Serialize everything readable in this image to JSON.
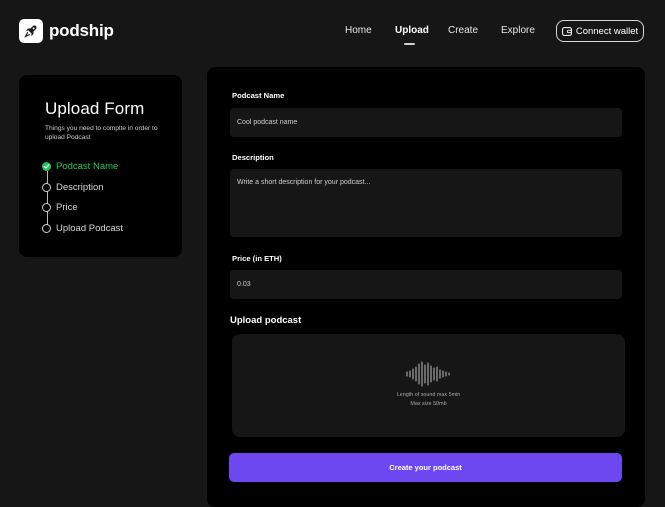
{
  "header": {
    "brand": "podship",
    "nav": [
      {
        "label": "Home",
        "active": false
      },
      {
        "label": "Upload",
        "active": true
      },
      {
        "label": "Create",
        "active": false
      },
      {
        "label": "Explore",
        "active": false
      }
    ],
    "wallet_button": "Connect wallet",
    "logo_icon": "rocket-icon",
    "wallet_icon": "wallet-icon"
  },
  "sidebar": {
    "title": "Upload Form",
    "subtitle": "Things you need to complte in order to upload Podcast",
    "steps": [
      {
        "label": "Podcast Name",
        "done": true
      },
      {
        "label": "Description",
        "done": false
      },
      {
        "label": "Price",
        "done": false
      },
      {
        "label": "Upload Podcast",
        "done": false
      }
    ]
  },
  "form": {
    "name_label": "Podcast Name",
    "name_placeholder": "Cool podcast name",
    "description_label": "Description",
    "description_placeholder": "Write a short description for your podcast...",
    "price_label": "Price (in ETH)",
    "price_value": "0.03",
    "upload_label": "Upload podcast",
    "upload_hint_1": "Length of sound max 5min",
    "upload_hint_2": "Max size 50mb",
    "submit_label": "Create your podcast"
  },
  "colors": {
    "accent": "#6d48f0",
    "success": "#22c55e",
    "background": "#161616",
    "card": "#000000"
  }
}
